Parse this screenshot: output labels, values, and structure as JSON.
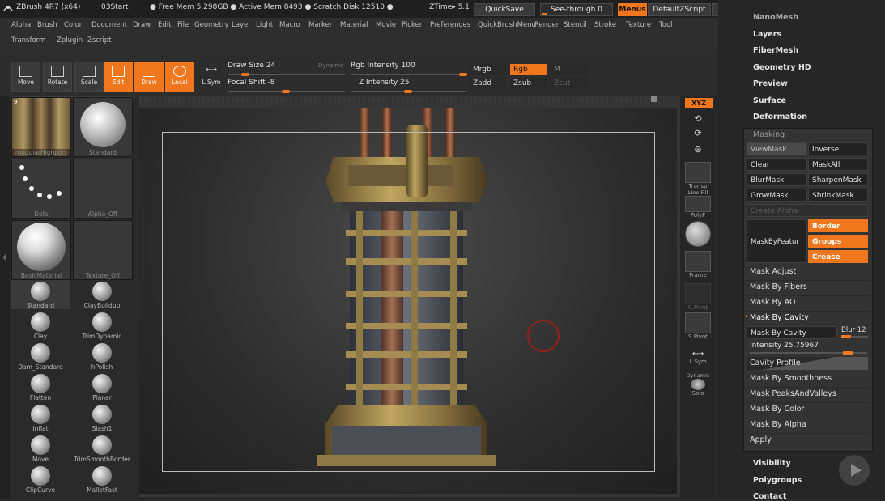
{
  "titlebar": {
    "app": "ZBrush 4R7 (x64)",
    "project": "03Start",
    "free_mem": "● Free Mem 5.298GB ● Active Mem 8493 ● Scratch Disk 12510 ●",
    "ztime": "ZTime▸ 5.1",
    "quicksave": "QuickSave",
    "seethrough": "See-through",
    "seethrough_val": "0",
    "menus": "Menus",
    "script": "DefaultZScript"
  },
  "menubar": {
    "row1": [
      "Alpha",
      "Brush",
      "Color",
      "Document",
      "Draw",
      "Edit",
      "File",
      "Geometry",
      "Layer",
      "Light",
      "Macro",
      "Marker",
      "Material",
      "Movie",
      "Picker",
      "Preferences",
      "QuickBrushMenu",
      "Render",
      "Stencil",
      "Stroke",
      "Texture",
      "Tool"
    ],
    "row2": [
      "Transform",
      "Zplugin",
      "Zscript"
    ]
  },
  "shelf": {
    "move": "Move",
    "rotate": "Rotate",
    "scale": "Scale",
    "edit": "Edit",
    "draw": "Draw",
    "local": "Local",
    "lsym": "L.Sym",
    "draw_size": "Draw Size 24",
    "dynamic": "Dynamic",
    "focal_shift": "Focal Shift -8",
    "rgb_intensity": "Rgb Intensity 100",
    "z_intensity": "Z Intensity 25",
    "mrgb": "Mrgb",
    "rgb": "Rgb",
    "m": "M",
    "zadd": "Zadd",
    "zsub": "Zsub",
    "zcut": "Zcut",
    "draw_size_level": 0.24,
    "focal_shift_level": 0.46,
    "rgb_intensity_level": 1.0,
    "z_intensity_level": 0.25
  },
  "leftpanel": {
    "thumbs": [
      {
        "label": "modularHighpoly",
        "badge": "9"
      },
      {
        "label": "Standard"
      },
      {
        "label": "Dots"
      },
      {
        "label": "Alpha_Off"
      },
      {
        "label": "BasicMaterial"
      },
      {
        "label": "Texture_Off"
      }
    ],
    "brushes": [
      "Standard",
      "ClayBuildup",
      "Clay",
      "TrimDynamic",
      "Dam_Standard",
      "hPolish",
      "Flatten",
      "Planar",
      "Inflat",
      "Slash1",
      "Move",
      "TrimSmoothBorder",
      "ClipCurve",
      "MalletFast"
    ]
  },
  "rightshelf": {
    "xyz": "XYZ",
    "transp": "Transp",
    "linefill": "Line Fill",
    "polyf": "PolyF",
    "bpr": "BPR",
    "frame": "Frame",
    "cpivot": "C.Pivot",
    "spivot": "S.Pivot",
    "lsym": "L.Sym",
    "dynamic": "Dynamic",
    "solo": "Solo"
  },
  "rightpanel": {
    "top_items": [
      "NanoMesh",
      "Layers",
      "FiberMesh",
      "Geometry HD",
      "Preview",
      "Surface",
      "Deformation"
    ],
    "masking_title": "Masking",
    "buttons": {
      "viewmask": "ViewMask",
      "inverse": "Inverse",
      "clear": "Clear",
      "maskall": "MaskAll",
      "blurmask": "BlurMask",
      "sharpenmask": "SharpenMask",
      "growmask": "GrowMask",
      "shrinkmask": "ShrinkMask",
      "create_alpha": "Create Alpha",
      "maskbyfeature": "MaskByFeatur",
      "border": "Border",
      "groups": "Groups",
      "crease": "Crease"
    },
    "rows": {
      "mask_adjust": "Mask Adjust",
      "mask_by_fibers": "Mask By Fibers",
      "mask_by_ao": "Mask By AO",
      "mask_by_cavity": "Mask By Cavity",
      "mask_by_cavity_btn": "Mask By Cavity",
      "blur": "Blur 12",
      "intensity": "Intensity 25.75967",
      "cavity_profile": "Cavity Profile",
      "mask_by_smoothness": "Mask By Smoothness",
      "mask_peaks_valleys": "Mask PeaksAndValleys",
      "mask_by_color": "Mask By Color",
      "mask_by_alpha": "Mask By Alpha",
      "apply": "Apply"
    },
    "bottom_items": [
      "Visibility",
      "Polygroups",
      "Contact"
    ]
  },
  "colors": {
    "accent": "#f0771e",
    "panel": "#333333",
    "bg": "#2a2a2a"
  },
  "icons": [
    "zbrush-logo-icon",
    "move-icon",
    "rotate-icon",
    "scale-icon",
    "edit-icon",
    "draw-icon",
    "local-icon",
    "lsym-icon",
    "play-icon"
  ]
}
